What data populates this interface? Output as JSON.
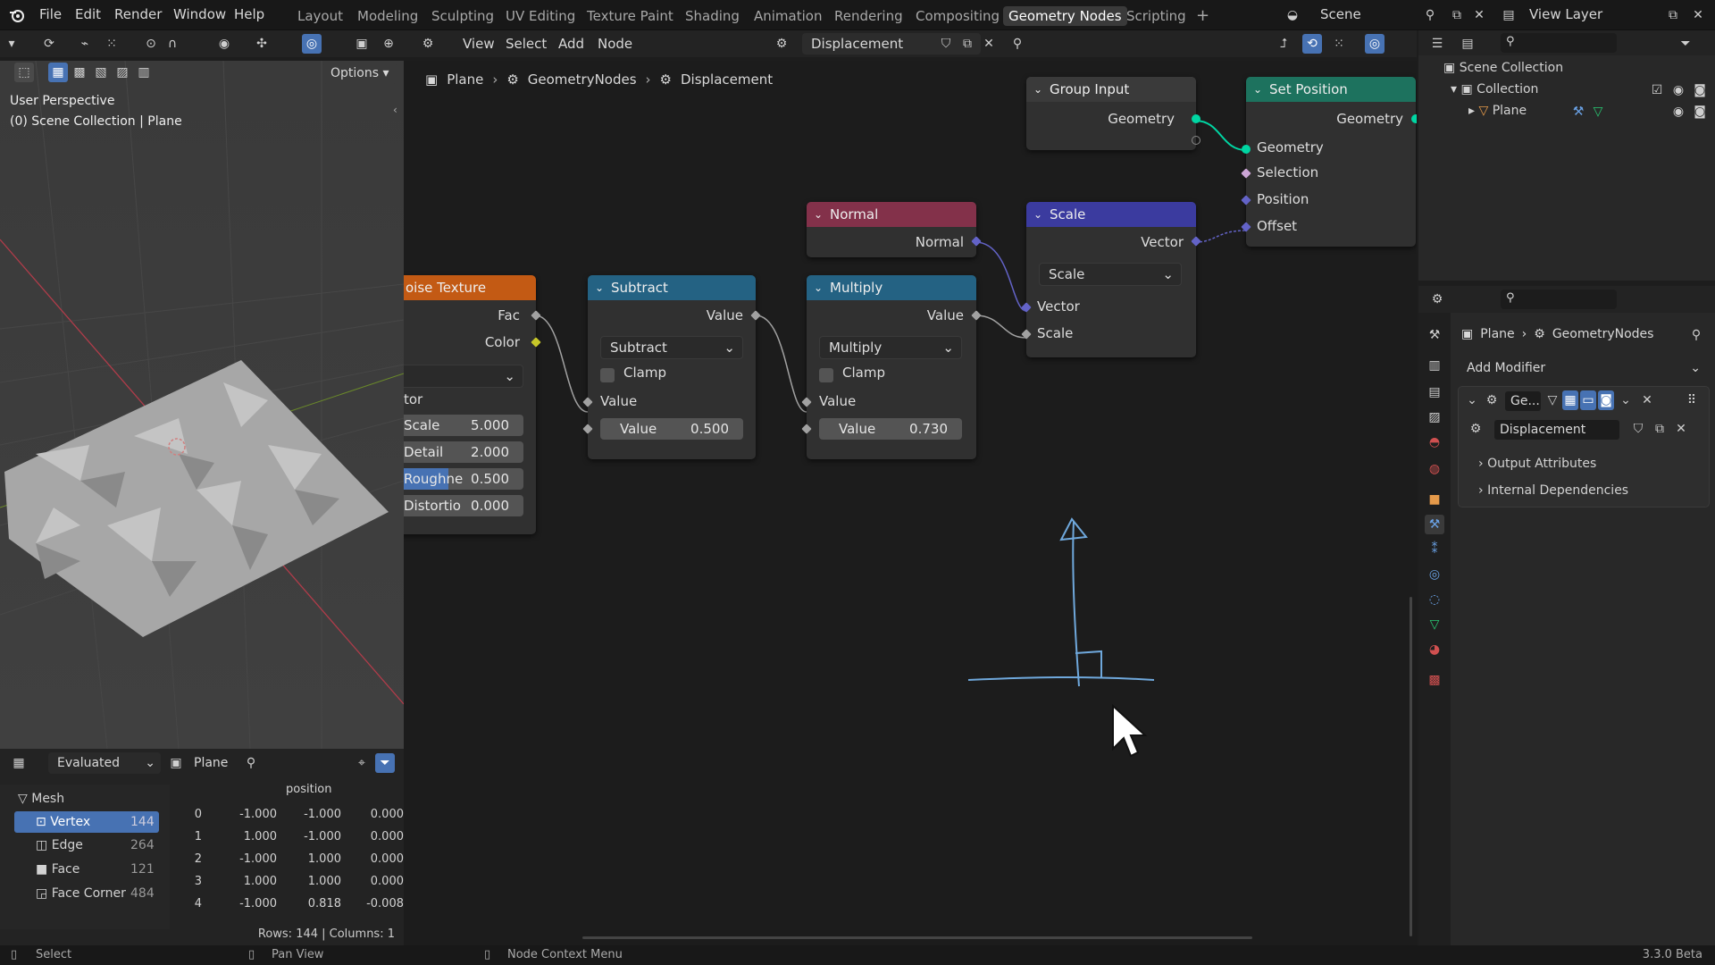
{
  "top_menu": [
    "File",
    "Edit",
    "Render",
    "Window",
    "Help"
  ],
  "workspace_tabs": [
    "Layout",
    "Modeling",
    "Sculpting",
    "UV Editing",
    "Texture Paint",
    "Shading",
    "Animation",
    "Rendering",
    "Compositing",
    "Geometry Nodes",
    "Scripting"
  ],
  "active_tab": "Geometry Nodes",
  "scene_name": "Scene",
  "view_layer": "View Layer",
  "viewport": {
    "options_label": "Options",
    "perspective_label": "User Perspective",
    "collection_label": "(0) Scene Collection | Plane"
  },
  "node_editor": {
    "menu": [
      "View",
      "Select",
      "Add",
      "Node"
    ],
    "node_tree_name": "Displacement",
    "breadcrumb": [
      "Plane",
      "GeometryNodes",
      "Displacement"
    ]
  },
  "nodes": {
    "group_input": {
      "title": "Group Input",
      "output": "Geometry"
    },
    "set_position": {
      "title": "Set Position",
      "output": "Geometry",
      "inputs": [
        "Geometry",
        "Selection",
        "Position",
        "Offset"
      ]
    },
    "normal": {
      "title": "Normal",
      "output": "Normal"
    },
    "scale": {
      "title": "Scale",
      "output": "Vector",
      "mode": "Scale",
      "inputs": [
        "Vector",
        "Scale"
      ]
    },
    "noise": {
      "title": "oise Texture",
      "outputs": [
        "Fac",
        "Color"
      ],
      "section": "tor",
      "fields": [
        {
          "label": "Scale",
          "value": "5.000"
        },
        {
          "label": "Detail",
          "value": "2.000"
        },
        {
          "label": "Roughne",
          "value": "0.500"
        },
        {
          "label": "Distortio",
          "value": "0.000"
        }
      ]
    },
    "subtract": {
      "title": "Subtract",
      "output": "Value",
      "mode": "Subtract",
      "clamp": "Clamp",
      "input_label": "Value",
      "field_label": "Value",
      "field_value": "0.500"
    },
    "multiply": {
      "title": "Multiply",
      "output": "Value",
      "mode": "Multiply",
      "clamp": "Clamp",
      "input_label": "Value",
      "field_label": "Value",
      "field_value": "0.730"
    }
  },
  "spreadsheet": {
    "mode": "Evaluated",
    "object": "Plane",
    "column_header": "position",
    "tree": [
      {
        "label": "Mesh",
        "count": ""
      },
      {
        "label": "Vertex",
        "count": "144"
      },
      {
        "label": "Edge",
        "count": "264"
      },
      {
        "label": "Face",
        "count": "121"
      },
      {
        "label": "Face Corner",
        "count": "484"
      }
    ],
    "rows": [
      {
        "idx": "0",
        "x": "-1.000",
        "y": "-1.000",
        "z": "0.000"
      },
      {
        "idx": "1",
        "x": "1.000",
        "y": "-1.000",
        "z": "0.000"
      },
      {
        "idx": "2",
        "x": "-1.000",
        "y": "1.000",
        "z": "0.000"
      },
      {
        "idx": "3",
        "x": "1.000",
        "y": "1.000",
        "z": "0.000"
      },
      {
        "idx": "4",
        "x": "-1.000",
        "y": "0.818",
        "z": "-0.008"
      }
    ],
    "footer": "Rows: 144   |   Columns: 1"
  },
  "outliner": {
    "scene_collection": "Scene Collection",
    "collection": "Collection",
    "plane": "Plane"
  },
  "properties": {
    "breadcrumb": [
      "Plane",
      "GeometryNodes"
    ],
    "add_modifier": "Add Modifier",
    "modifier_short": "Ge...",
    "node_group": "Displacement",
    "subpanels": [
      "Output Attributes",
      "Internal Dependencies"
    ]
  },
  "statusbar": {
    "select": "Select",
    "pan": "Pan View",
    "context": "Node Context Menu",
    "version": "3.3.0 Beta"
  },
  "colors": {
    "geometry_socket": "#00d6a3",
    "vector_socket": "#6363c7",
    "float_socket": "#a1a1a1",
    "color_socket": "#c7c729",
    "header_input": "#3a3a3a",
    "header_geometry": "#1d725e",
    "header_vector": "#3b3b9f",
    "header_converter": "#246283",
    "header_texture": "#e66100",
    "header_normal": "#83314a",
    "annotation": "#6fa8dc"
  }
}
